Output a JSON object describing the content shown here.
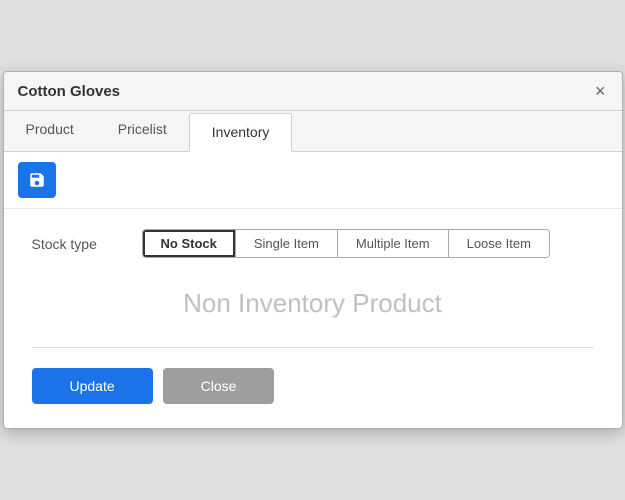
{
  "dialog": {
    "title": "Cotton Gloves",
    "close_label": "×"
  },
  "tabs": [
    {
      "id": "product",
      "label": "Product",
      "active": false
    },
    {
      "id": "pricelist",
      "label": "Pricelist",
      "active": false
    },
    {
      "id": "inventory",
      "label": "Inventory",
      "active": true
    }
  ],
  "toolbar": {
    "save_icon": "save-icon"
  },
  "stock_type": {
    "label": "Stock type",
    "options": [
      {
        "id": "no-stock",
        "label": "No Stock",
        "selected": true
      },
      {
        "id": "single-item",
        "label": "Single Item",
        "selected": false
      },
      {
        "id": "multiple-item",
        "label": "Multiple Item",
        "selected": false
      },
      {
        "id": "loose-item",
        "label": "Loose Item",
        "selected": false
      }
    ]
  },
  "content": {
    "non_inventory_text": "Non Inventory Product"
  },
  "actions": {
    "update_label": "Update",
    "close_label": "Close"
  }
}
